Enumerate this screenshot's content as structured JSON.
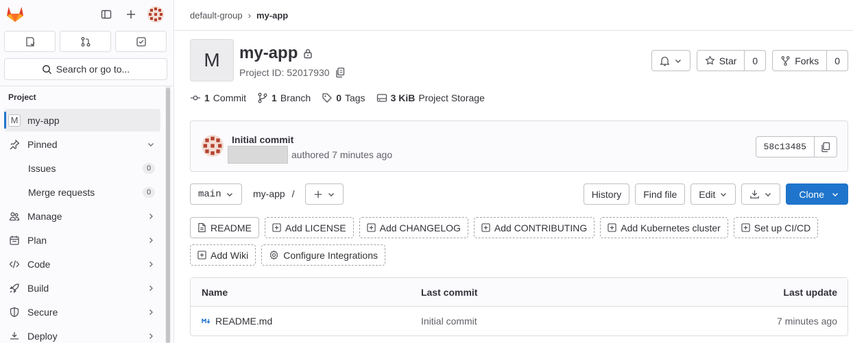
{
  "sidebar": {
    "section_heading": "Project",
    "search_label": "Search or go to...",
    "items": [
      {
        "label": "my-app",
        "icon": "project-avatar-M",
        "avatar_letter": "M"
      },
      {
        "label": "Pinned",
        "icon": "thumbtack-icon"
      },
      {
        "label": "Issues",
        "count": "0"
      },
      {
        "label": "Merge requests",
        "count": "0"
      },
      {
        "label": "Manage",
        "icon": "users-icon"
      },
      {
        "label": "Plan",
        "icon": "calendar-icon"
      },
      {
        "label": "Code",
        "icon": "code-icon"
      },
      {
        "label": "Build",
        "icon": "rocket-icon"
      },
      {
        "label": "Secure",
        "icon": "shield-icon"
      },
      {
        "label": "Deploy",
        "icon": "deploy-icon"
      }
    ]
  },
  "breadcrumb": {
    "parent": "default-group",
    "separator": "›",
    "current": "my-app"
  },
  "project": {
    "avatar_letter": "M",
    "name": "my-app",
    "id_label": "Project ID: 52017930",
    "star_label": "Star",
    "star_count": "0",
    "forks_label": "Forks",
    "forks_count": "0"
  },
  "stats": {
    "commits_count": "1",
    "commits_label": "Commit",
    "branches_count": "1",
    "branches_label": "Branch",
    "tags_count": "0",
    "tags_label": "Tags",
    "storage_count": "3 KiB",
    "storage_label": "Project Storage"
  },
  "commit": {
    "title": "Initial commit",
    "meta": "authored 7 minutes ago",
    "sha": "58c13485"
  },
  "toolbar": {
    "branch": "main",
    "path": "my-app",
    "path_sep": "/",
    "history": "History",
    "find_file": "Find file",
    "edit": "Edit",
    "clone": "Clone"
  },
  "shortcuts": [
    "README",
    "Add LICENSE",
    "Add CHANGELOG",
    "Add CONTRIBUTING",
    "Add Kubernetes cluster",
    "Set up CI/CD",
    "Add Wiki",
    "Configure Integrations"
  ],
  "files": {
    "headers": [
      "Name",
      "Last commit",
      "Last update"
    ],
    "rows": [
      {
        "name": "README.md",
        "last_commit": "Initial commit",
        "last_update": "7 minutes ago"
      }
    ]
  },
  "colors": {
    "accent": "#1f75cb",
    "logo_orange": "#e24329"
  }
}
